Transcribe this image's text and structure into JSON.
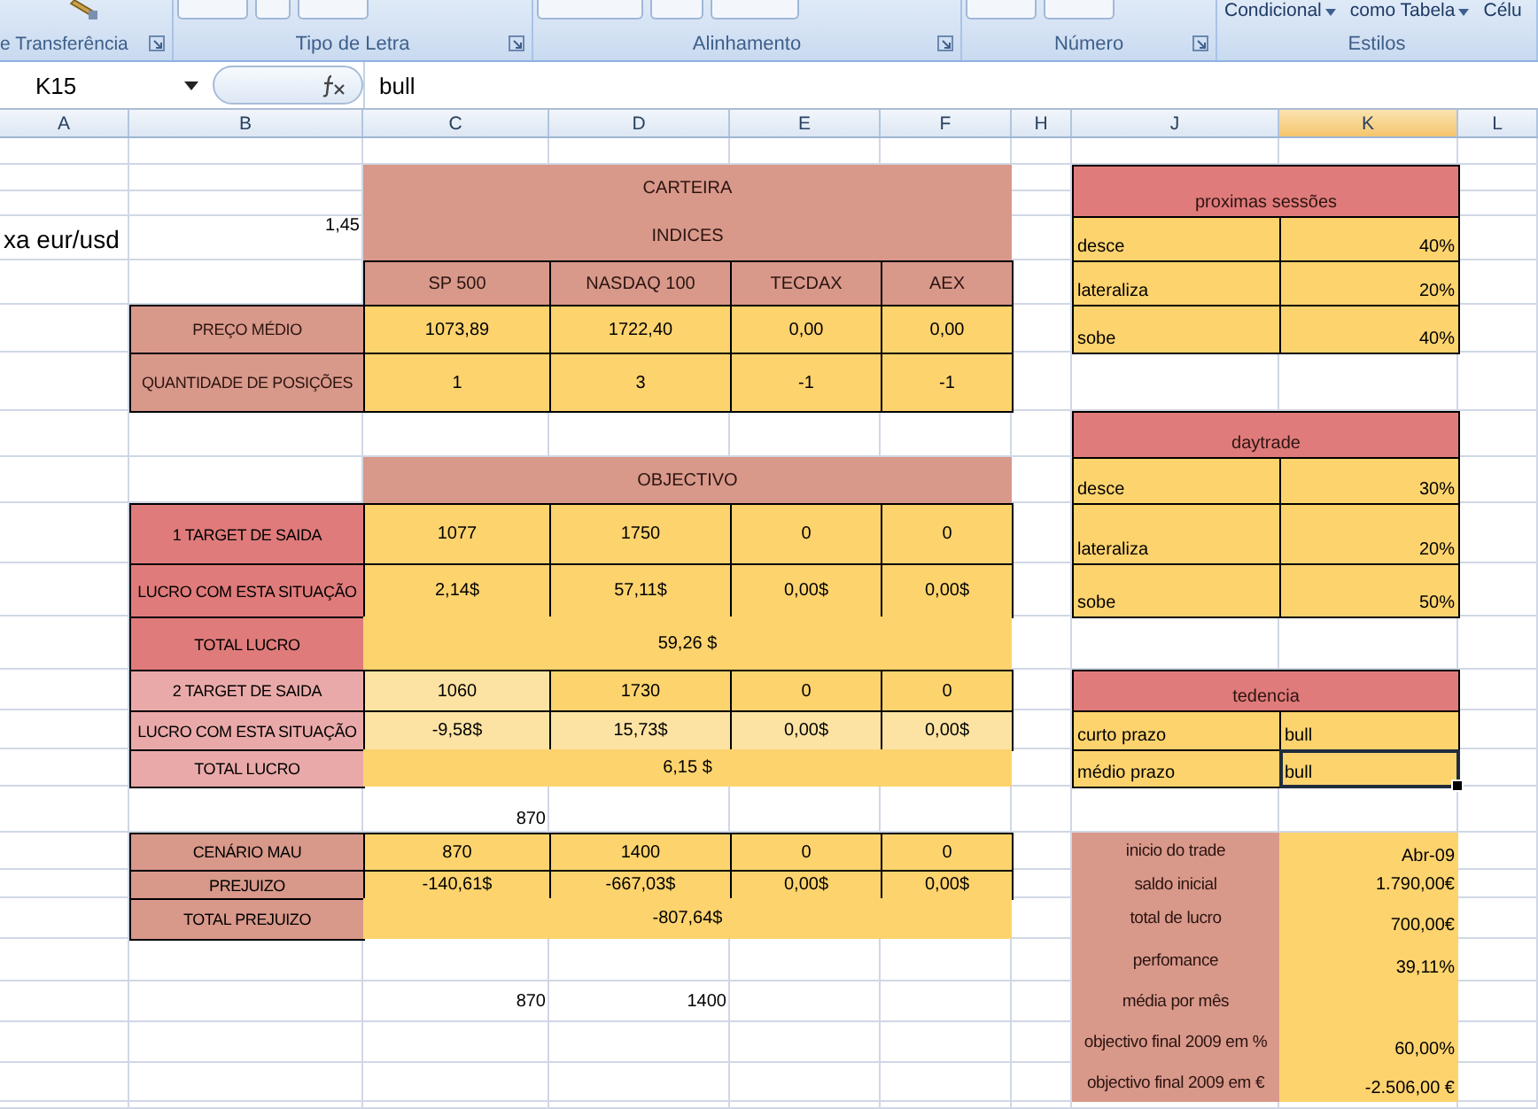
{
  "ribbon": {
    "groups": [
      {
        "label": "e Transferência",
        "has_launcher": true
      },
      {
        "label": "Tipo de Letra",
        "has_launcher": true
      },
      {
        "label": "Alinhamento",
        "has_launcher": true
      },
      {
        "label": "Número",
        "has_launcher": true
      },
      {
        "label": "Estilos",
        "has_launcher": false
      }
    ],
    "style_buttons": [
      "Condicional",
      "como Tabela",
      "Célu"
    ]
  },
  "formula_bar": {
    "name_box": "K15",
    "formula": "bull"
  },
  "columns": [
    {
      "label": "A",
      "selected": false
    },
    {
      "label": "B",
      "selected": false
    },
    {
      "label": "C",
      "selected": false
    },
    {
      "label": "D",
      "selected": false
    },
    {
      "label": "E",
      "selected": false
    },
    {
      "label": "F",
      "selected": false
    },
    {
      "label": "H",
      "selected": false
    },
    {
      "label": "J",
      "selected": false
    },
    {
      "label": "K",
      "selected": true
    },
    {
      "label": "L",
      "selected": false
    }
  ],
  "portfolio": {
    "exchange_rate_label": "xa eur/usd",
    "exchange_rate": "1,45",
    "title": "CARTEIRA",
    "subtitle": "INDICES",
    "indices": [
      "SP 500",
      "NASDAQ 100",
      "TECDAX",
      "AEX"
    ],
    "rows": [
      {
        "label": "PREÇO MÉDIO",
        "cells": [
          {
            "text": "1073,89",
            "pale": false
          },
          {
            "text": "1722,40",
            "pale": false
          },
          {
            "text": "0,00",
            "pale": false
          },
          {
            "text": "0,00",
            "pale": false
          }
        ]
      },
      {
        "label": "QUANTIDADE DE POSIÇÕES",
        "cells": [
          {
            "text": "1",
            "pale": false
          },
          {
            "text": "3",
            "pale": false
          },
          {
            "text": "-1",
            "pale": false
          },
          {
            "text": "-1",
            "pale": false
          }
        ]
      }
    ]
  },
  "objective": {
    "title": "OBJECTIVO",
    "rows": [
      {
        "kind": "values",
        "label": "1 TARGET DE SAIDA",
        "color": "#e07b7b",
        "cells": [
          {
            "text": "1077",
            "pale": false
          },
          {
            "text": "1750",
            "pale": false
          },
          {
            "text": "0",
            "pale": false
          },
          {
            "text": "0",
            "pale": false
          }
        ]
      },
      {
        "kind": "values",
        "label": "LUCRO COM ESTA SITUAÇÃO",
        "color": "#e07b7b",
        "cells": [
          {
            "text": "2,14$",
            "pale": false
          },
          {
            "text": "57,11$",
            "pale": false
          },
          {
            "text": "0,00$",
            "pale": false
          },
          {
            "text": "0,00$",
            "pale": false
          }
        ]
      },
      {
        "kind": "total",
        "label": "TOTAL LUCRO",
        "color": "#e07b7b",
        "total": "59,26 $"
      },
      {
        "kind": "values",
        "label": "2 TARGET DE SAIDA",
        "color": "#eaa9a9",
        "cells": [
          {
            "text": "1060",
            "pale": true
          },
          {
            "text": "1730",
            "pale": false
          },
          {
            "text": "0",
            "pale": false
          },
          {
            "text": "0",
            "pale": false
          }
        ]
      },
      {
        "kind": "values",
        "label": "LUCRO COM ESTA SITUAÇÃO",
        "color": "#eaa9a9",
        "cells": [
          {
            "text": "-9,58$",
            "pale": true
          },
          {
            "text": "15,73$",
            "pale": true
          },
          {
            "text": "0,00$",
            "pale": true
          },
          {
            "text": "0,00$",
            "pale": true
          }
        ]
      },
      {
        "kind": "total",
        "label": "TOTAL LUCRO",
        "color": "#eaa9a9",
        "total": "6,15 $"
      }
    ]
  },
  "loose_value": "870",
  "bad_scenario": {
    "rows": [
      {
        "kind": "values",
        "label": "CENÁRIO MAU",
        "color": "#d8988a",
        "cells": [
          {
            "text": "870",
            "pale": false
          },
          {
            "text": "1400",
            "pale": false
          },
          {
            "text": "0",
            "pale": false
          },
          {
            "text": "0",
            "pale": false
          }
        ]
      },
      {
        "kind": "values",
        "label": "PREJUIZO",
        "color": "#d8988a",
        "cells": [
          {
            "text": "-140,61$",
            "pale": false
          },
          {
            "text": "-667,03$",
            "pale": false
          },
          {
            "text": "0,00$",
            "pale": false
          },
          {
            "text": "0,00$",
            "pale": false
          }
        ]
      },
      {
        "kind": "total",
        "label": "TOTAL  PREJUIZO",
        "color": "#d8988a",
        "total": "-807,64$"
      }
    ]
  },
  "footer_values": [
    "870",
    "1400"
  ],
  "next_sessions": {
    "title": "proximas sessões",
    "rows": [
      {
        "label": "desce",
        "value": "40%"
      },
      {
        "label": "lateraliza",
        "value": "20%"
      },
      {
        "label": "sobe",
        "value": "40%"
      }
    ]
  },
  "daytrade": {
    "title": "daytrade",
    "rows": [
      {
        "label": "desce",
        "value": "30%"
      },
      {
        "label": "lateraliza",
        "value": "20%"
      },
      {
        "label": "sobe",
        "value": "50%"
      }
    ]
  },
  "trend": {
    "title": "tedencia",
    "rows": [
      {
        "label": "curto prazo",
        "value": "bull",
        "selected": false
      },
      {
        "label": "médio prazo",
        "value": "bull",
        "selected": true
      }
    ]
  },
  "summary": {
    "rows": [
      {
        "label": "inicio do trade",
        "value": "Abr-09"
      },
      {
        "label": "saldo inicial",
        "value": "1.790,00€"
      },
      {
        "label": "total de lucro",
        "value": "700,00€"
      },
      {
        "label": "perfomance",
        "value": "39,11%"
      },
      {
        "label": "média por mês"
      },
      {
        "label": "objectivo final 2009 em %",
        "value": "60,00%"
      },
      {
        "label": "objectivo final 2009 em €",
        "value": "-2.506,00 €"
      }
    ]
  }
}
